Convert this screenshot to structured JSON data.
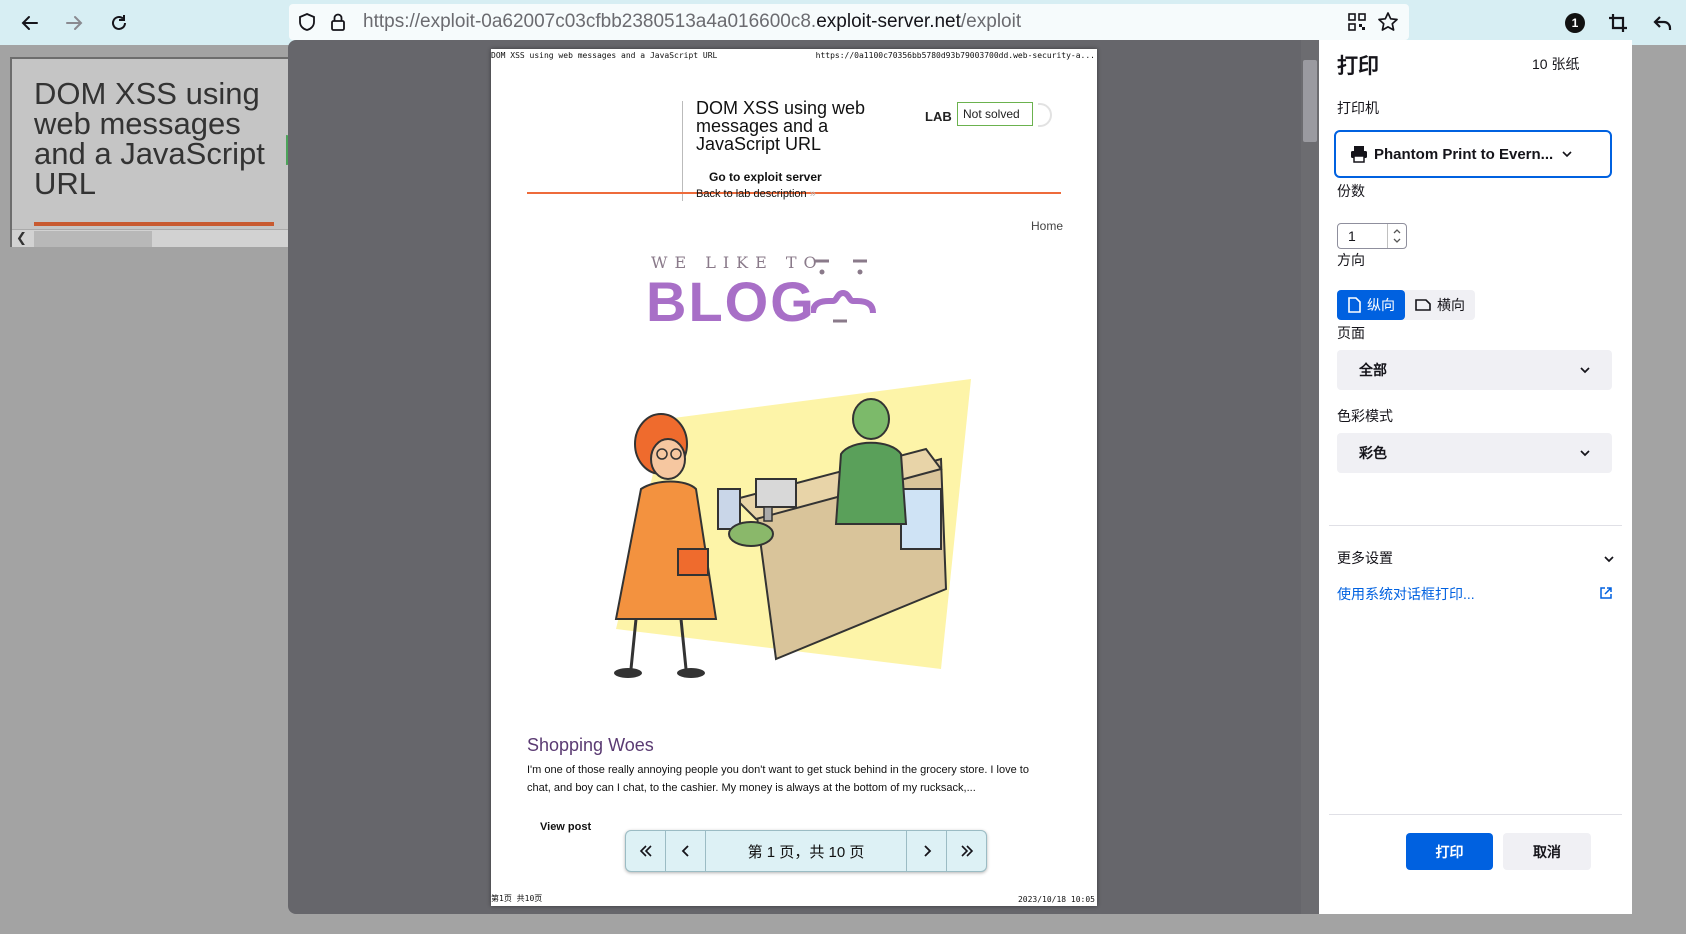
{
  "toolbar": {
    "url_prefix": "https://exploit-0a62007c03cfbb2380513a4a016600c8.",
    "url_domain": "exploit-server.net",
    "url_path": "/exploit",
    "badge_count": "1"
  },
  "background_page": {
    "title": "DOM XSS using web messages and a JavaScript URL"
  },
  "preview": {
    "header_left": "DOM XSS using web messages and a JavaScript URL",
    "header_right": "https://0a1100c70356bb5780d93b79003700dd.web-security-a...",
    "lab_title": "DOM XSS using web messages and a JavaScript URL",
    "lab_label": "LAB",
    "lab_status": "Not solved",
    "go_exploit": "Go to exploit server",
    "back_lab": "Back to lab description",
    "home": "Home",
    "logo_top": "WE LIKE TO",
    "logo_main": "BLOG",
    "post_title": "Shopping Woes",
    "post_excerpt": "I'm one of those really annoying people you don't want to get stuck behind in the grocery store. I love to chat, and boy can I chat, to the cashier. My money is always at the bottom of my rucksack,...",
    "view_post": "View post",
    "footer_left": "第1页 共10页",
    "footer_right": "2023/10/18 10:05"
  },
  "pager": {
    "text": "第 1 页，共 10 页"
  },
  "panel": {
    "title": "打印",
    "sheet_count": "10 张纸",
    "printer_label": "打印机",
    "printer_value": "Phantom Print to Evern...",
    "copies_label": "份数",
    "copies_value": "1",
    "orientation_label": "方向",
    "portrait": "纵向",
    "landscape": "横向",
    "pages_label": "页面",
    "pages_value": "全部",
    "color_label": "色彩模式",
    "color_value": "彩色",
    "more_settings": "更多设置",
    "system_dialog": "使用系统对话框打印...",
    "print_button": "打印",
    "cancel_button": "取消"
  },
  "colors": {
    "accent": "#0061e0",
    "toolbar_bg": "#d7eef3",
    "blog_purple": "#a86fc7",
    "lab_orange": "#ee6b3b"
  }
}
